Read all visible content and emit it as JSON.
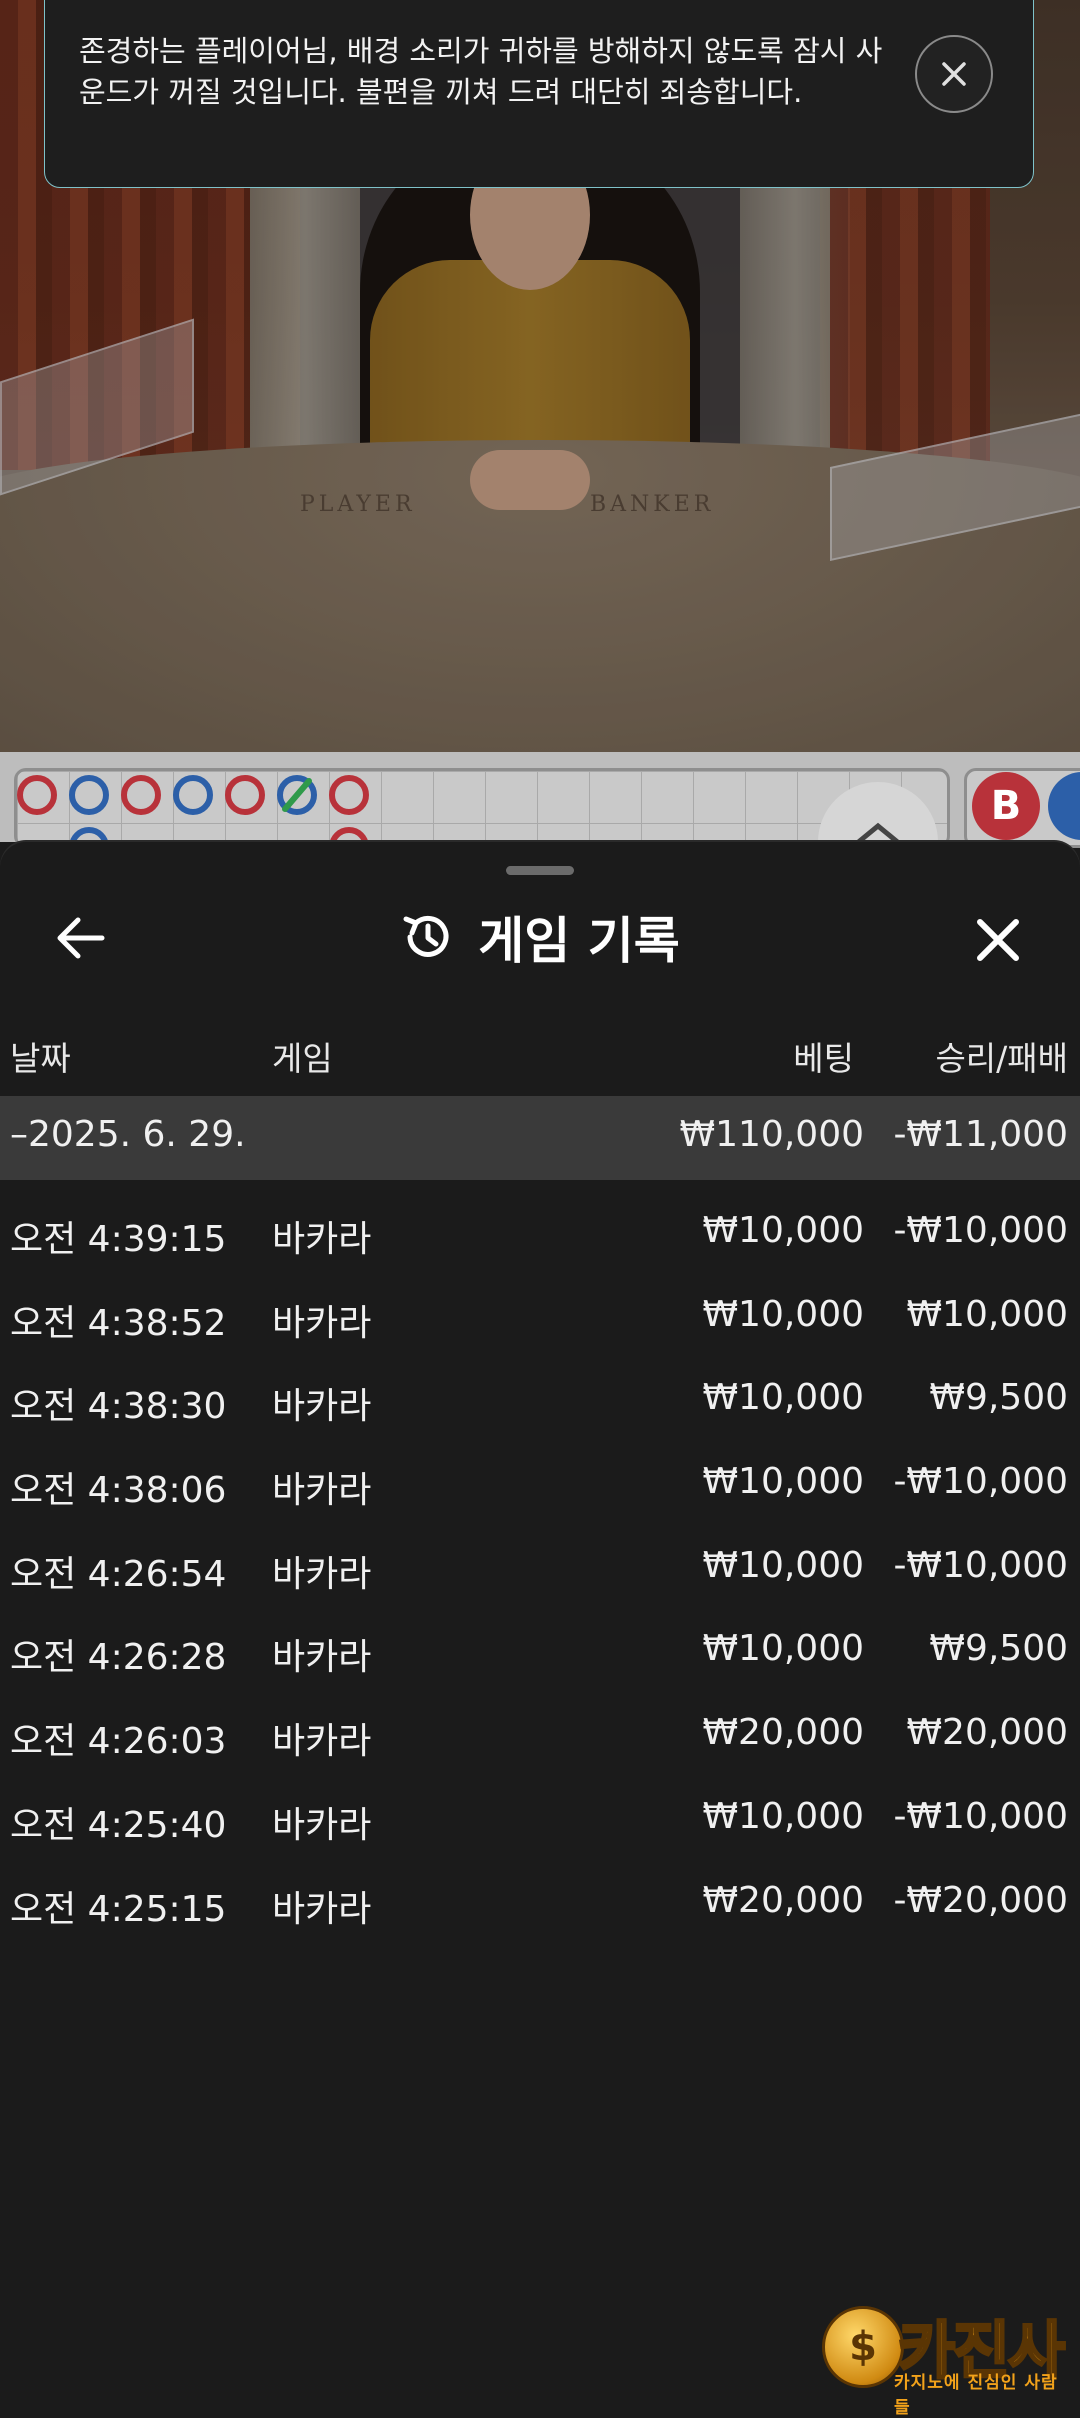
{
  "toast": {
    "message": "존경하는 플레이어님, 배경 소리가 귀하를 방해하지 않도록 잠시 사운드가 꺼질 것입니다. 불편을 끼쳐 드려 대단히 죄송합니다."
  },
  "video": {
    "table_label_player": "PLAYER",
    "table_label_banker": "BANKER"
  },
  "roadmap": {
    "banker_badge": "B",
    "beads_top_row": [
      "red",
      "blue",
      "red",
      "blue",
      "red",
      "blue-slash",
      "red"
    ],
    "beads_second_row": [
      "blue",
      "red"
    ]
  },
  "history": {
    "title": "게임 기록",
    "columns": {
      "date": "날짜",
      "game": "게임",
      "bet": "베팅",
      "result": "승리/패배"
    },
    "summary": {
      "date": "–2025. 6. 29.",
      "bet": "₩110,000",
      "result": "-₩11,000"
    },
    "rows": [
      {
        "time": "오전 4:39:15",
        "game": "바카라",
        "bet": "₩10,000",
        "result": "-₩10,000"
      },
      {
        "time": "오전 4:38:52",
        "game": "바카라",
        "bet": "₩10,000",
        "result": "₩10,000"
      },
      {
        "time": "오전 4:38:30",
        "game": "바카라",
        "bet": "₩10,000",
        "result": "₩9,500"
      },
      {
        "time": "오전 4:38:06",
        "game": "바카라",
        "bet": "₩10,000",
        "result": "-₩10,000"
      },
      {
        "time": "오전 4:26:54",
        "game": "바카라",
        "bet": "₩10,000",
        "result": "-₩10,000"
      },
      {
        "time": "오전 4:26:28",
        "game": "바카라",
        "bet": "₩10,000",
        "result": "₩9,500"
      },
      {
        "time": "오전 4:26:03",
        "game": "바카라",
        "bet": "₩20,000",
        "result": "₩20,000"
      },
      {
        "time": "오전 4:25:40",
        "game": "바카라",
        "bet": "₩10,000",
        "result": "-₩10,000"
      },
      {
        "time": "오전 4:25:15",
        "game": "바카라",
        "bet": "₩20,000",
        "result": "-₩20,000"
      }
    ]
  },
  "watermark": {
    "brand": "카진사",
    "tagline": "카지노에 진심인 사람들",
    "coin_symbol": "$"
  },
  "colors": {
    "banker_red": "#b8323a",
    "player_blue": "#2c5fa8",
    "sheet_bg": "#1b1b1b",
    "summary_bg": "#3a3a3a",
    "toast_border": "#7fc2c9"
  }
}
